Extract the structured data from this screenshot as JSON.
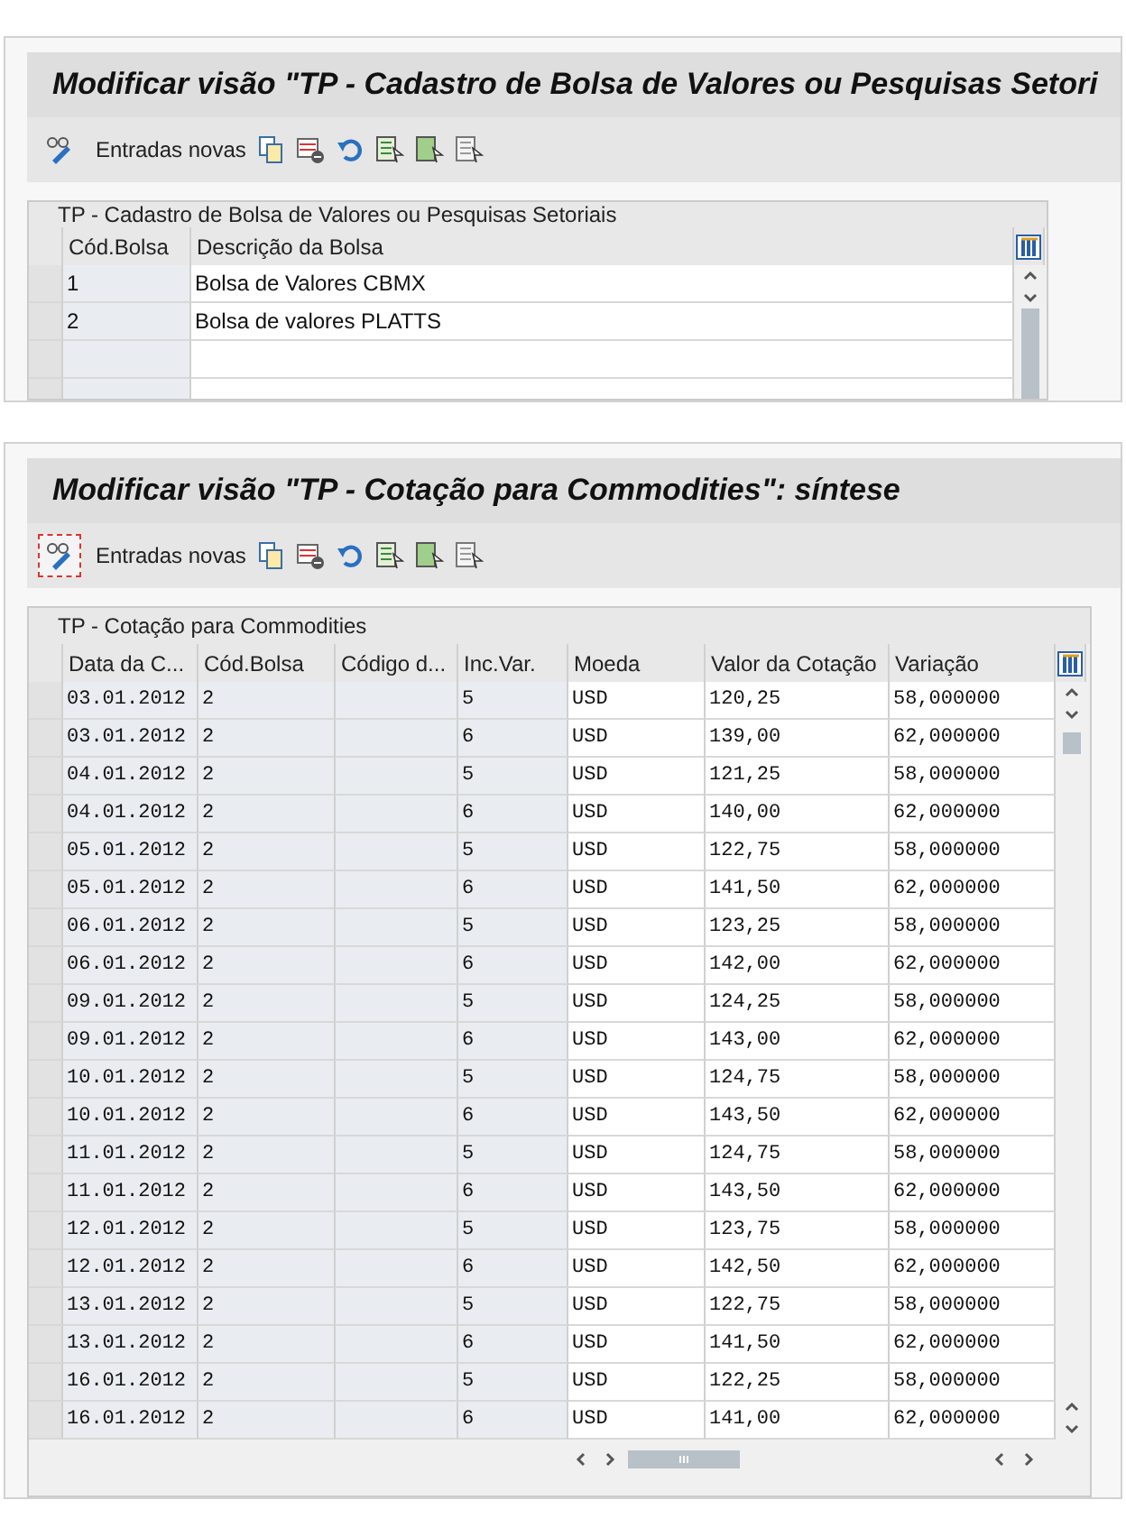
{
  "panels": [
    {
      "title": "Modificar visão \"TP - Cadastro de Bolsa de Valores ou Pesquisas Setori",
      "toolbar": {
        "new_entries": {
          "label": "Entradas novas",
          "focused": false
        }
      },
      "table": {
        "title": "TP - Cadastro de Bolsa de Valores ou Pesquisas Setoriais",
        "columns": [
          {
            "label": "Cód.Bolsa",
            "key": true
          },
          {
            "label": "Descrição da Bolsa",
            "key": false
          }
        ],
        "rows": [
          [
            "1",
            "Bolsa de Valores CBMX"
          ],
          [
            "2",
            "Bolsa de valores PLATTS"
          ]
        ]
      }
    },
    {
      "title": "Modificar visão \"TP - Cotação para Commodities\": síntese",
      "toolbar": {
        "new_entries": {
          "label": "Entradas novas",
          "focused": true
        }
      },
      "table": {
        "title": "TP - Cotação para Commodities",
        "columns": [
          {
            "label": "Data da C...",
            "key": true
          },
          {
            "label": "Cód.Bolsa",
            "key": true
          },
          {
            "label": "Código d...",
            "key": true
          },
          {
            "label": "Inc.Var.",
            "key": true
          },
          {
            "label": "Moeda",
            "key": false
          },
          {
            "label": "Valor da Cotação",
            "key": false
          },
          {
            "label": "Variação",
            "key": false
          }
        ],
        "rows": [
          [
            "03.01.2012",
            "2",
            "",
            "5",
            "USD",
            "120,25",
            "58,000000"
          ],
          [
            "03.01.2012",
            "2",
            "",
            "6",
            "USD",
            "139,00",
            "62,000000"
          ],
          [
            "04.01.2012",
            "2",
            "",
            "5",
            "USD",
            "121,25",
            "58,000000"
          ],
          [
            "04.01.2012",
            "2",
            "",
            "6",
            "USD",
            "140,00",
            "62,000000"
          ],
          [
            "05.01.2012",
            "2",
            "",
            "5",
            "USD",
            "122,75",
            "58,000000"
          ],
          [
            "05.01.2012",
            "2",
            "",
            "6",
            "USD",
            "141,50",
            "62,000000"
          ],
          [
            "06.01.2012",
            "2",
            "",
            "5",
            "USD",
            "123,25",
            "58,000000"
          ],
          [
            "06.01.2012",
            "2",
            "",
            "6",
            "USD",
            "142,00",
            "62,000000"
          ],
          [
            "09.01.2012",
            "2",
            "",
            "5",
            "USD",
            "124,25",
            "58,000000"
          ],
          [
            "09.01.2012",
            "2",
            "",
            "6",
            "USD",
            "143,00",
            "62,000000"
          ],
          [
            "10.01.2012",
            "2",
            "",
            "5",
            "USD",
            "124,75",
            "58,000000"
          ],
          [
            "10.01.2012",
            "2",
            "",
            "6",
            "USD",
            "143,50",
            "62,000000"
          ],
          [
            "11.01.2012",
            "2",
            "",
            "5",
            "USD",
            "124,75",
            "58,000000"
          ],
          [
            "11.01.2012",
            "2",
            "",
            "6",
            "USD",
            "143,50",
            "62,000000"
          ],
          [
            "12.01.2012",
            "2",
            "",
            "5",
            "USD",
            "123,75",
            "58,000000"
          ],
          [
            "12.01.2012",
            "2",
            "",
            "6",
            "USD",
            "142,50",
            "62,000000"
          ],
          [
            "13.01.2012",
            "2",
            "",
            "5",
            "USD",
            "122,75",
            "58,000000"
          ],
          [
            "13.01.2012",
            "2",
            "",
            "6",
            "USD",
            "141,50",
            "62,000000"
          ],
          [
            "16.01.2012",
            "2",
            "",
            "5",
            "USD",
            "122,25",
            "58,000000"
          ],
          [
            "16.01.2012",
            "2",
            "",
            "6",
            "USD",
            "141,00",
            "62,000000"
          ]
        ]
      }
    }
  ]
}
